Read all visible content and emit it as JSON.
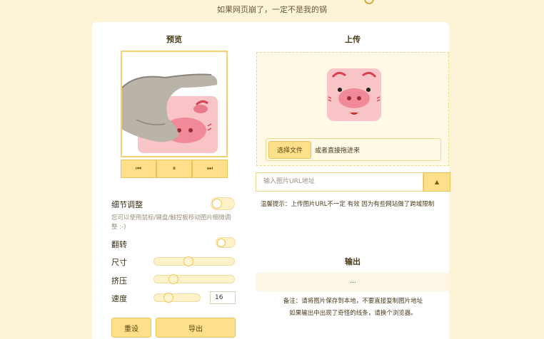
{
  "header": {
    "tagline": "如果网页崩了，一定不是我的锅"
  },
  "preview": {
    "title": "预览",
    "controls": {
      "prev": "⏮",
      "pause": "⏸",
      "next": "⏭"
    }
  },
  "settings": {
    "detail_label": "细节调整",
    "detail_note": "您可以使用鼠标/键盘/触控板移动图片细微调整 :-)",
    "flip_label": "翻转",
    "size_label": "尺寸",
    "squeeze_label": "挤压",
    "speed_label": "速度",
    "speed_value": "16",
    "size_level": 0.42,
    "squeeze_level": 0.2,
    "speed_level": 0.25,
    "reset_button": "重设",
    "export_button": "导出"
  },
  "upload": {
    "title": "上传",
    "choose_file": "选择文件",
    "drag_hint": "或者直接拖进来",
    "url_placeholder": "输入图片URL地址",
    "upload_icon": "upload-arrow-icon",
    "tip": "温馨提示：上传图片URL不一定 有效 因为有些网站做了跨域限制"
  },
  "output": {
    "title": "输出",
    "placeholder": "...",
    "remark1": "备注：请将图片保存到本地，不要直接复制图片地址",
    "remark2": "如果输出中出现了奇怪的线条，请换个浏览器。"
  },
  "colors": {
    "accent": "#ffe08a",
    "accent_border": "#e8c25a",
    "background": "#fdf4d8"
  }
}
